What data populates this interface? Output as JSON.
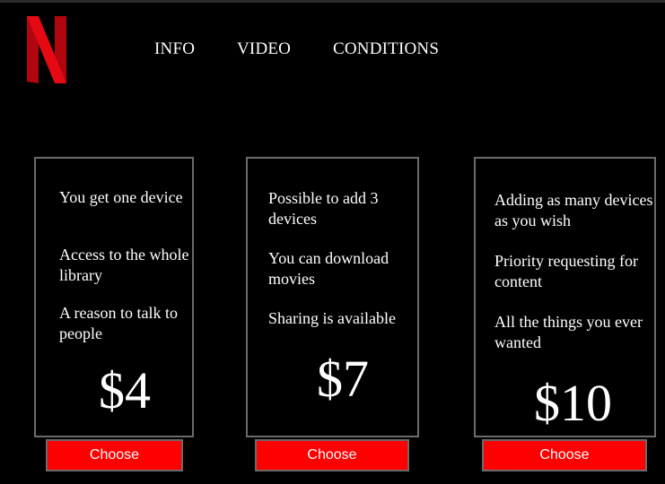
{
  "brand": {
    "accent": "#ff0000",
    "logo_letter": "N"
  },
  "nav": {
    "items": [
      "INFO",
      "VIDEO",
      "CONDITIONS"
    ]
  },
  "plans": [
    {
      "features": [
        "You get one device",
        "Access to the whole library",
        "A reason to talk to people"
      ],
      "price": "$4",
      "button": "Choose"
    },
    {
      "features": [
        "Possible to add 3 devices",
        "You can download movies",
        "Sharing is available"
      ],
      "price": "$7",
      "button": "Choose"
    },
    {
      "features": [
        "Adding as many devices as you wish",
        "Priority requesting for content",
        "All the things you ever wanted"
      ],
      "price": "$10",
      "button": "Choose"
    }
  ]
}
